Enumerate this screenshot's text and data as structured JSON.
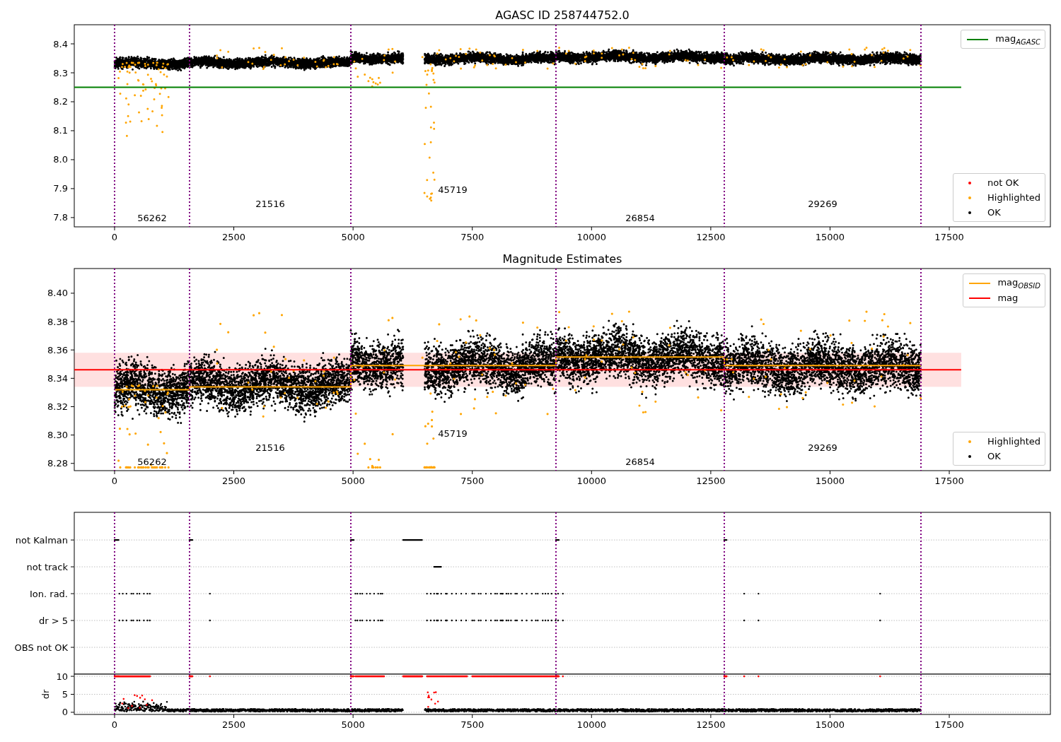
{
  "figure": {
    "panels": [
      {
        "chart_data": {
          "type": "scatter",
          "title": "AGASC ID 258744752.0",
          "xlim": [
            -845,
            19620
          ],
          "ylim": [
            7.768,
            8.466
          ],
          "xticks": [
            {
              "value": 0,
              "label": "0"
            },
            {
              "value": 2500,
              "label": "2500"
            },
            {
              "value": 5000,
              "label": "5000"
            },
            {
              "value": 7500,
              "label": "7500"
            },
            {
              "value": 10000,
              "label": "10000"
            },
            {
              "value": 12500,
              "label": "12500"
            },
            {
              "value": 15000,
              "label": "15000"
            },
            {
              "value": 17500,
              "label": "17500"
            }
          ],
          "yticks": [
            {
              "value": 7.8,
              "label": "7.8"
            },
            {
              "value": 7.9,
              "label": "7.9"
            },
            {
              "value": 8.0,
              "label": "8.0"
            },
            {
              "value": 8.1,
              "label": "8.1"
            },
            {
              "value": 8.2,
              "label": "8.2"
            },
            {
              "value": 8.3,
              "label": "8.3"
            },
            {
              "value": 8.4,
              "label": "8.4"
            }
          ],
          "series": [
            {
              "name": "mag$_{AGASC}$",
              "type": "line",
              "color": "#008000",
              "x": [
                -845,
                17750
              ],
              "values": [
                8.25,
                8.25
              ]
            }
          ],
          "ref_lines": [
            {
              "axis": "x",
              "value": 0,
              "color": "#800080"
            },
            {
              "axis": "x",
              "value": 1572,
              "color": "#800080"
            },
            {
              "axis": "x",
              "value": 4953,
              "color": "#800080"
            },
            {
              "axis": "x",
              "value": 9254,
              "color": "#800080"
            },
            {
              "axis": "x",
              "value": 12783,
              "color": "#800080"
            },
            {
              "axis": "x",
              "value": 16906,
              "color": "#800080"
            }
          ],
          "annotations": [
            "56262",
            "21516",
            "45719",
            "26854",
            "29269"
          ]
        },
        "marker_legend": [
          {
            "label": "not OK",
            "color": "#ff0000"
          },
          {
            "label": "Highlighted",
            "color": "#ffa500"
          },
          {
            "label": "OK",
            "color": "#000000"
          }
        ]
      },
      {
        "chart_data": {
          "type": "scatter",
          "title": "Magnitude Estimates",
          "xlim": [
            -845,
            19620
          ],
          "ylim": [
            8.2749,
            8.4174
          ],
          "xticks": [
            {
              "value": 0,
              "label": "0"
            },
            {
              "value": 2500,
              "label": "2500"
            },
            {
              "value": 5000,
              "label": "5000"
            },
            {
              "value": 7500,
              "label": "7500"
            },
            {
              "value": 10000,
              "label": "10000"
            },
            {
              "value": 12500,
              "label": "12500"
            },
            {
              "value": 15000,
              "label": "15000"
            },
            {
              "value": 17500,
              "label": "17500"
            }
          ],
          "yticks": [
            {
              "value": 8.28,
              "label": "8.28"
            },
            {
              "value": 8.3,
              "label": "8.30"
            },
            {
              "value": 8.32,
              "label": "8.32"
            },
            {
              "value": 8.34,
              "label": "8.34"
            },
            {
              "value": 8.36,
              "label": "8.36"
            },
            {
              "value": 8.38,
              "label": "8.38"
            },
            {
              "value": 8.4,
              "label": "8.40"
            }
          ],
          "series": [
            {
              "name": "mag$_{OBSID}$",
              "type": "line",
              "color": "#ffa500",
              "x": [
                0,
                1572,
                1572,
                4953,
                4953,
                9254,
                9254,
                12783,
                12783,
                16906
              ],
              "values": [
                8.332,
                8.332,
                8.334,
                8.334,
                8.349,
                8.349,
                8.355,
                8.355,
                8.349,
                8.349
              ]
            },
            {
              "name": "mag",
              "type": "line",
              "color": "#ff0000",
              "x": [
                -845,
                17750
              ],
              "values": [
                8.346,
                8.346
              ]
            }
          ],
          "bands": [
            {
              "axis": "y",
              "from": 8.334,
              "to": 8.358,
              "color": "#ff0000"
            }
          ],
          "ref_lines": [
            {
              "axis": "x",
              "value": 0,
              "color": "#800080"
            },
            {
              "axis": "x",
              "value": 1572,
              "color": "#800080"
            },
            {
              "axis": "x",
              "value": 4953,
              "color": "#800080"
            },
            {
              "axis": "x",
              "value": 9254,
              "color": "#800080"
            },
            {
              "axis": "x",
              "value": 12783,
              "color": "#800080"
            },
            {
              "axis": "x",
              "value": 16906,
              "color": "#800080"
            }
          ],
          "annotations": [
            "56262",
            "21516",
            "45719",
            "26854",
            "29269"
          ]
        },
        "marker_legend": [
          {
            "label": "Highlighted",
            "color": "#ffa500"
          },
          {
            "label": "OK",
            "color": "#000000"
          }
        ]
      },
      {
        "grid": true,
        "row_labels": [
          "not Kalman",
          "not track",
          "Ion. rad.",
          "dr > 5",
          "OBS not OK"
        ]
      },
      {
        "chart_data": {
          "type": "scatter",
          "grid": true,
          "ylabel": "dr",
          "xlim": [
            -845,
            19620
          ],
          "ylim": [
            -0.6,
            10.6
          ],
          "xticks": [
            {
              "value": 0,
              "label": "0"
            },
            {
              "value": 2500,
              "label": "2500"
            },
            {
              "value": 5000,
              "label": "5000"
            },
            {
              "value": 7500,
              "label": "7500"
            },
            {
              "value": 10000,
              "label": "10000"
            },
            {
              "value": 12500,
              "label": "12500"
            },
            {
              "value": 15000,
              "label": "15000"
            },
            {
              "value": 17500,
              "label": "17500"
            }
          ],
          "yticks": [
            {
              "value": 0,
              "label": "0"
            },
            {
              "value": 5,
              "label": "5"
            },
            {
              "value": 10,
              "label": "10"
            }
          ],
          "ref_lines": [
            {
              "axis": "x",
              "value": 0,
              "color": "#800080"
            },
            {
              "axis": "x",
              "value": 1572,
              "color": "#800080"
            },
            {
              "axis": "x",
              "value": 4953,
              "color": "#800080"
            },
            {
              "axis": "x",
              "value": 9254,
              "color": "#800080"
            },
            {
              "axis": "x",
              "value": 12783,
              "color": "#800080"
            },
            {
              "axis": "x",
              "value": 16906,
              "color": "#800080"
            }
          ]
        }
      }
    ]
  }
}
